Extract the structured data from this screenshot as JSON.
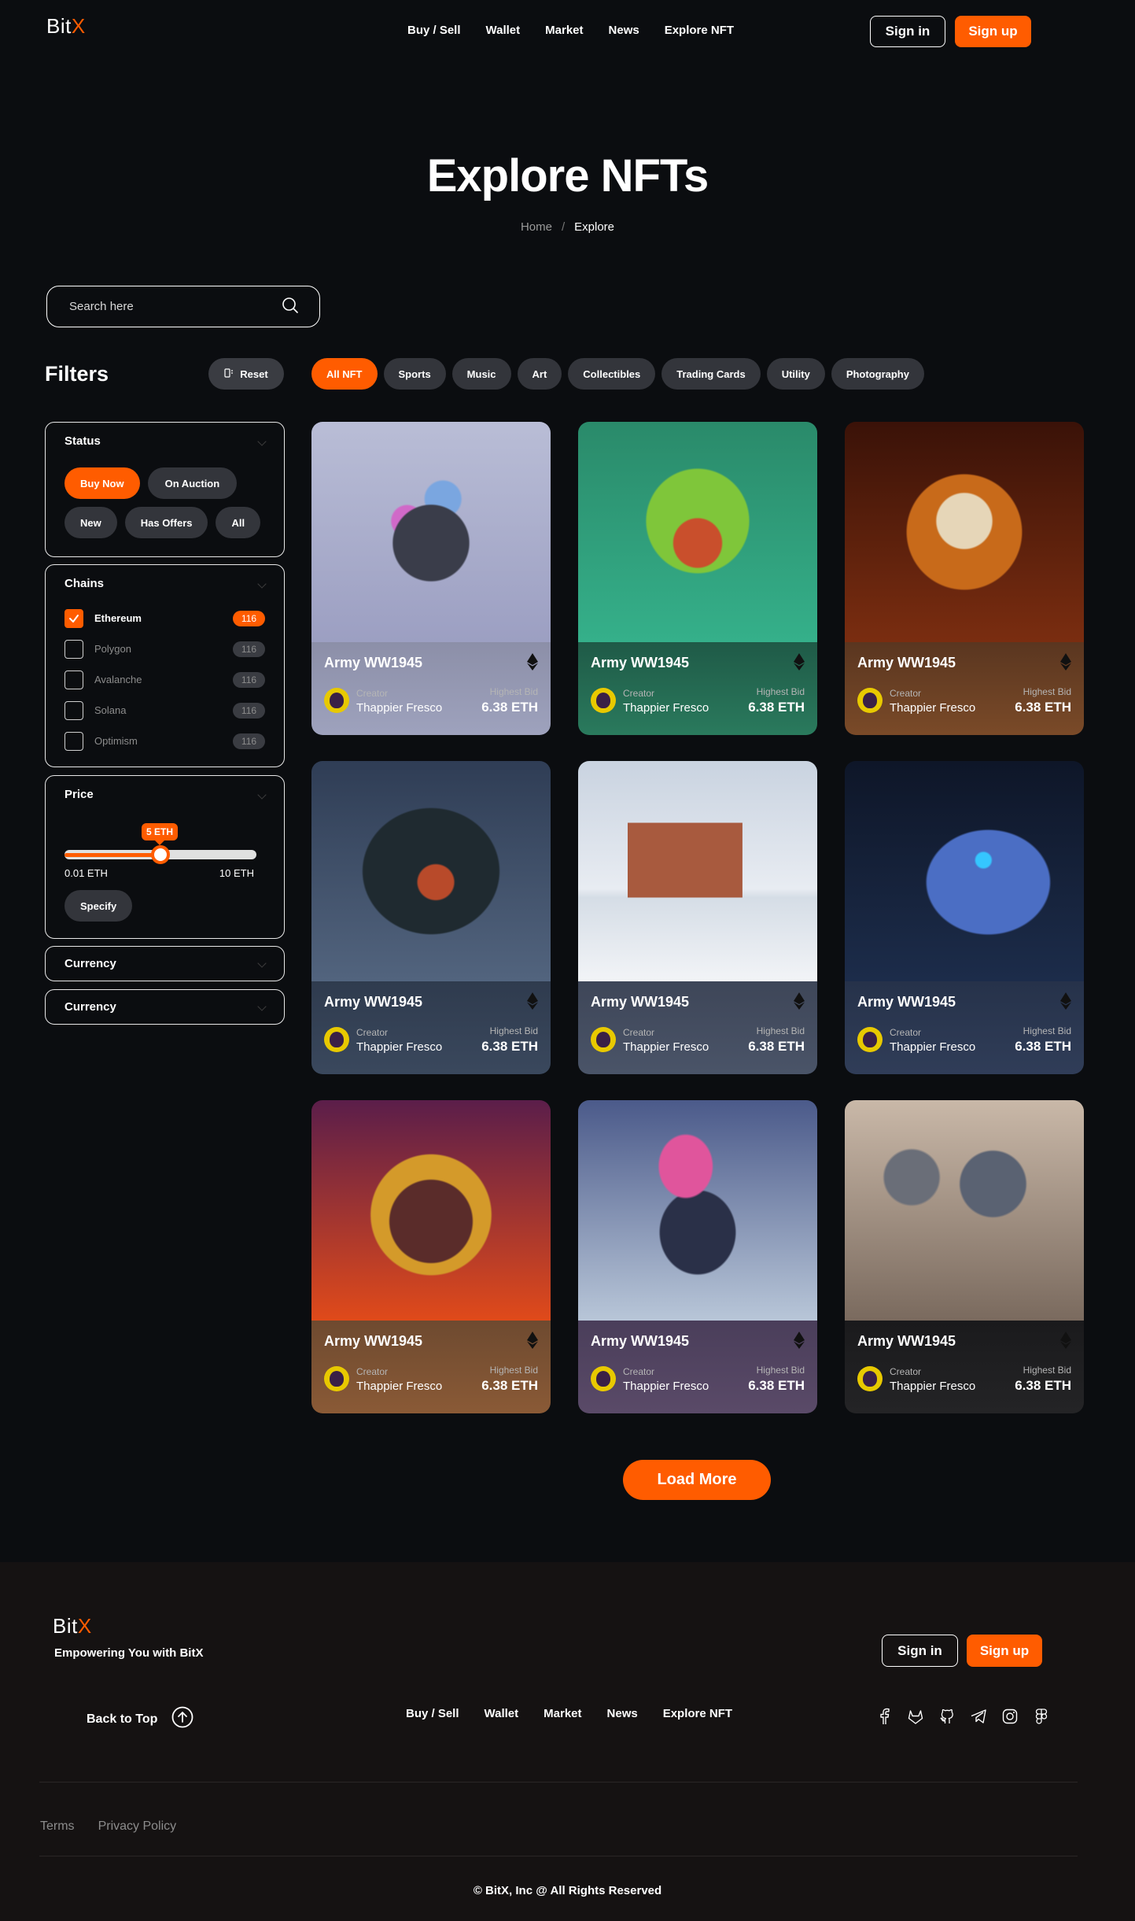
{
  "brand": {
    "name_prefix": "Bit",
    "name_accent": "X"
  },
  "nav": {
    "items": [
      "Buy / Sell",
      "Wallet",
      "Market",
      "News",
      "Explore NFT"
    ]
  },
  "auth": {
    "sign_in": "Sign in",
    "sign_up": "Sign up"
  },
  "hero": {
    "title": "Explore NFTs",
    "breadcrumb_home": "Home",
    "breadcrumb_sep": "/",
    "breadcrumb_current": "Explore"
  },
  "search": {
    "placeholder": "Search here"
  },
  "filters": {
    "title": "Filters",
    "reset_label": "Reset",
    "categories": [
      "All NFT",
      "Sports",
      "Music",
      "Art",
      "Collectibles",
      "Trading Cards",
      "Utility",
      "Photography"
    ],
    "active_category": "All NFT",
    "status": {
      "title": "Status",
      "options": [
        "Buy Now",
        "On Auction",
        "New",
        "Has Offers",
        "All"
      ],
      "active": "Buy Now"
    },
    "chains": {
      "title": "Chains",
      "items": [
        {
          "name": "Ethereum",
          "count": "116",
          "checked": true
        },
        {
          "name": "Polygon",
          "count": "116",
          "checked": false
        },
        {
          "name": "Avalanche",
          "count": "116",
          "checked": false
        },
        {
          "name": "Solana",
          "count": "116",
          "checked": false
        },
        {
          "name": "Optimism",
          "count": "116",
          "checked": false
        }
      ]
    },
    "price": {
      "title": "Price",
      "current_label": "5 ETH",
      "min_label": "0.01 ETH",
      "max_label": "10 ETH",
      "current_fraction": 0.5,
      "specify_label": "Specify"
    },
    "currency_1": {
      "title": "Currency"
    },
    "currency_2": {
      "title": "Currency"
    }
  },
  "cards": [
    {
      "title": "Army WW1945",
      "creator_label": "Creator",
      "creator": "Thappier Fresco",
      "bid_label": "Highest Bid",
      "bid": "6.38 ETH",
      "theme": "lavender-bust"
    },
    {
      "title": "Army WW1945",
      "creator_label": "Creator",
      "creator": "Thappier Fresco",
      "bid_label": "Highest Bid",
      "bid": "6.38 ETH",
      "theme": "green-coral"
    },
    {
      "title": "Army WW1945",
      "creator_label": "Creator",
      "creator": "Thappier Fresco",
      "bid_label": "Highest Bid",
      "bid": "6.38 ETH",
      "theme": "golden-skull"
    },
    {
      "title": "Army WW1945",
      "creator_label": "Creator",
      "creator": "Thappier Fresco",
      "bid_label": "Highest Bid",
      "bid": "6.38 ETH",
      "theme": "winged-warrior"
    },
    {
      "title": "Army WW1945",
      "creator_label": "Creator",
      "creator": "Thappier Fresco",
      "bid_label": "Highest Bid",
      "bid": "6.38 ETH",
      "theme": "desert-mesa"
    },
    {
      "title": "Army WW1945",
      "creator_label": "Creator",
      "creator": "Thappier Fresco",
      "bid_label": "Highest Bid",
      "bid": "6.38 ETH",
      "theme": "steel-eagle"
    },
    {
      "title": "Army WW1945",
      "creator_label": "Creator",
      "creator": "Thappier Fresco",
      "bid_label": "Highest Bid",
      "bid": "6.38 ETH",
      "theme": "space-dog"
    },
    {
      "title": "Army WW1945",
      "creator_label": "Creator",
      "creator": "Thappier Fresco",
      "bid_label": "Highest Bid",
      "bid": "6.38 ETH",
      "theme": "pink-dancer"
    },
    {
      "title": "Army WW1945",
      "creator_label": "Creator",
      "creator": "Thappier Fresco",
      "bid_label": "Highest Bid",
      "bid": "6.38 ETH",
      "theme": "alien-figures"
    }
  ],
  "load_more": "Load More",
  "footer": {
    "tagline": "Empowering You with BitX",
    "back_to_top": "Back to Top",
    "nav": [
      "Buy / Sell",
      "Wallet",
      "Market",
      "News",
      "Explore NFT"
    ],
    "socials": [
      "facebook-icon",
      "gitlab-icon",
      "github-icon",
      "telegram-icon",
      "instagram-icon",
      "figma-icon"
    ],
    "legal": [
      "Terms",
      "Privacy Policy"
    ],
    "copyright": "© BitX, Inc @ All Rights Reserved"
  },
  "colors": {
    "accent": "#ff5c00",
    "background": "#0b0d10",
    "footer": "#151212",
    "pill": "#33353b"
  }
}
